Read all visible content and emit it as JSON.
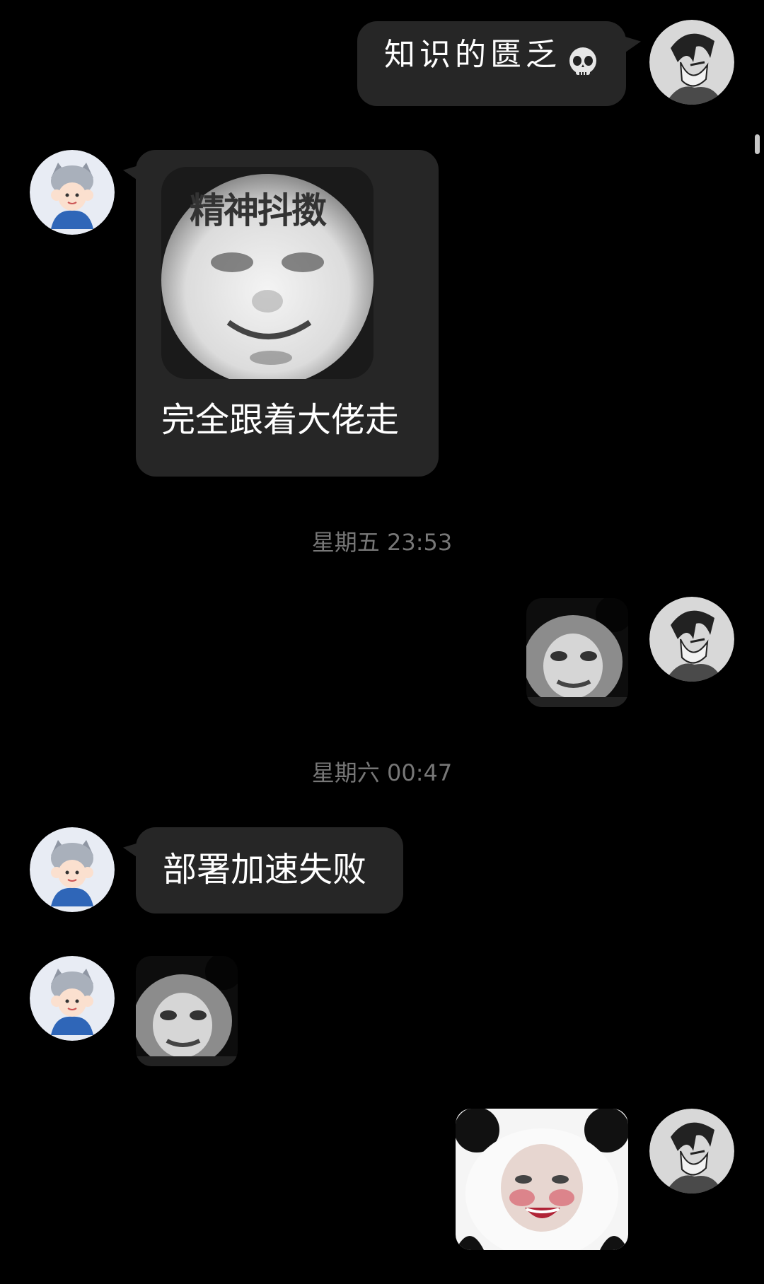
{
  "messages": [
    {
      "side": "right",
      "text": "知识的匮乏"
    },
    {
      "side": "left",
      "sticker_caption": "精神抖擞",
      "text": "完全跟着大佬走"
    },
    {
      "side": "right",
      "sticker": "panda-face-sticker"
    },
    {
      "side": "left",
      "text": "部署加速失败"
    },
    {
      "side": "left",
      "sticker": "panda-face-sticker"
    },
    {
      "side": "right",
      "sticker": "panda-laughing-sticker"
    }
  ],
  "timestamps": [
    "星期五 23:53",
    "星期六 00:47"
  ],
  "emoji": {
    "skull": "skull-emoji"
  },
  "colors": {
    "background": "#000000",
    "bubble": "#262626",
    "timestamp": "#777777"
  }
}
